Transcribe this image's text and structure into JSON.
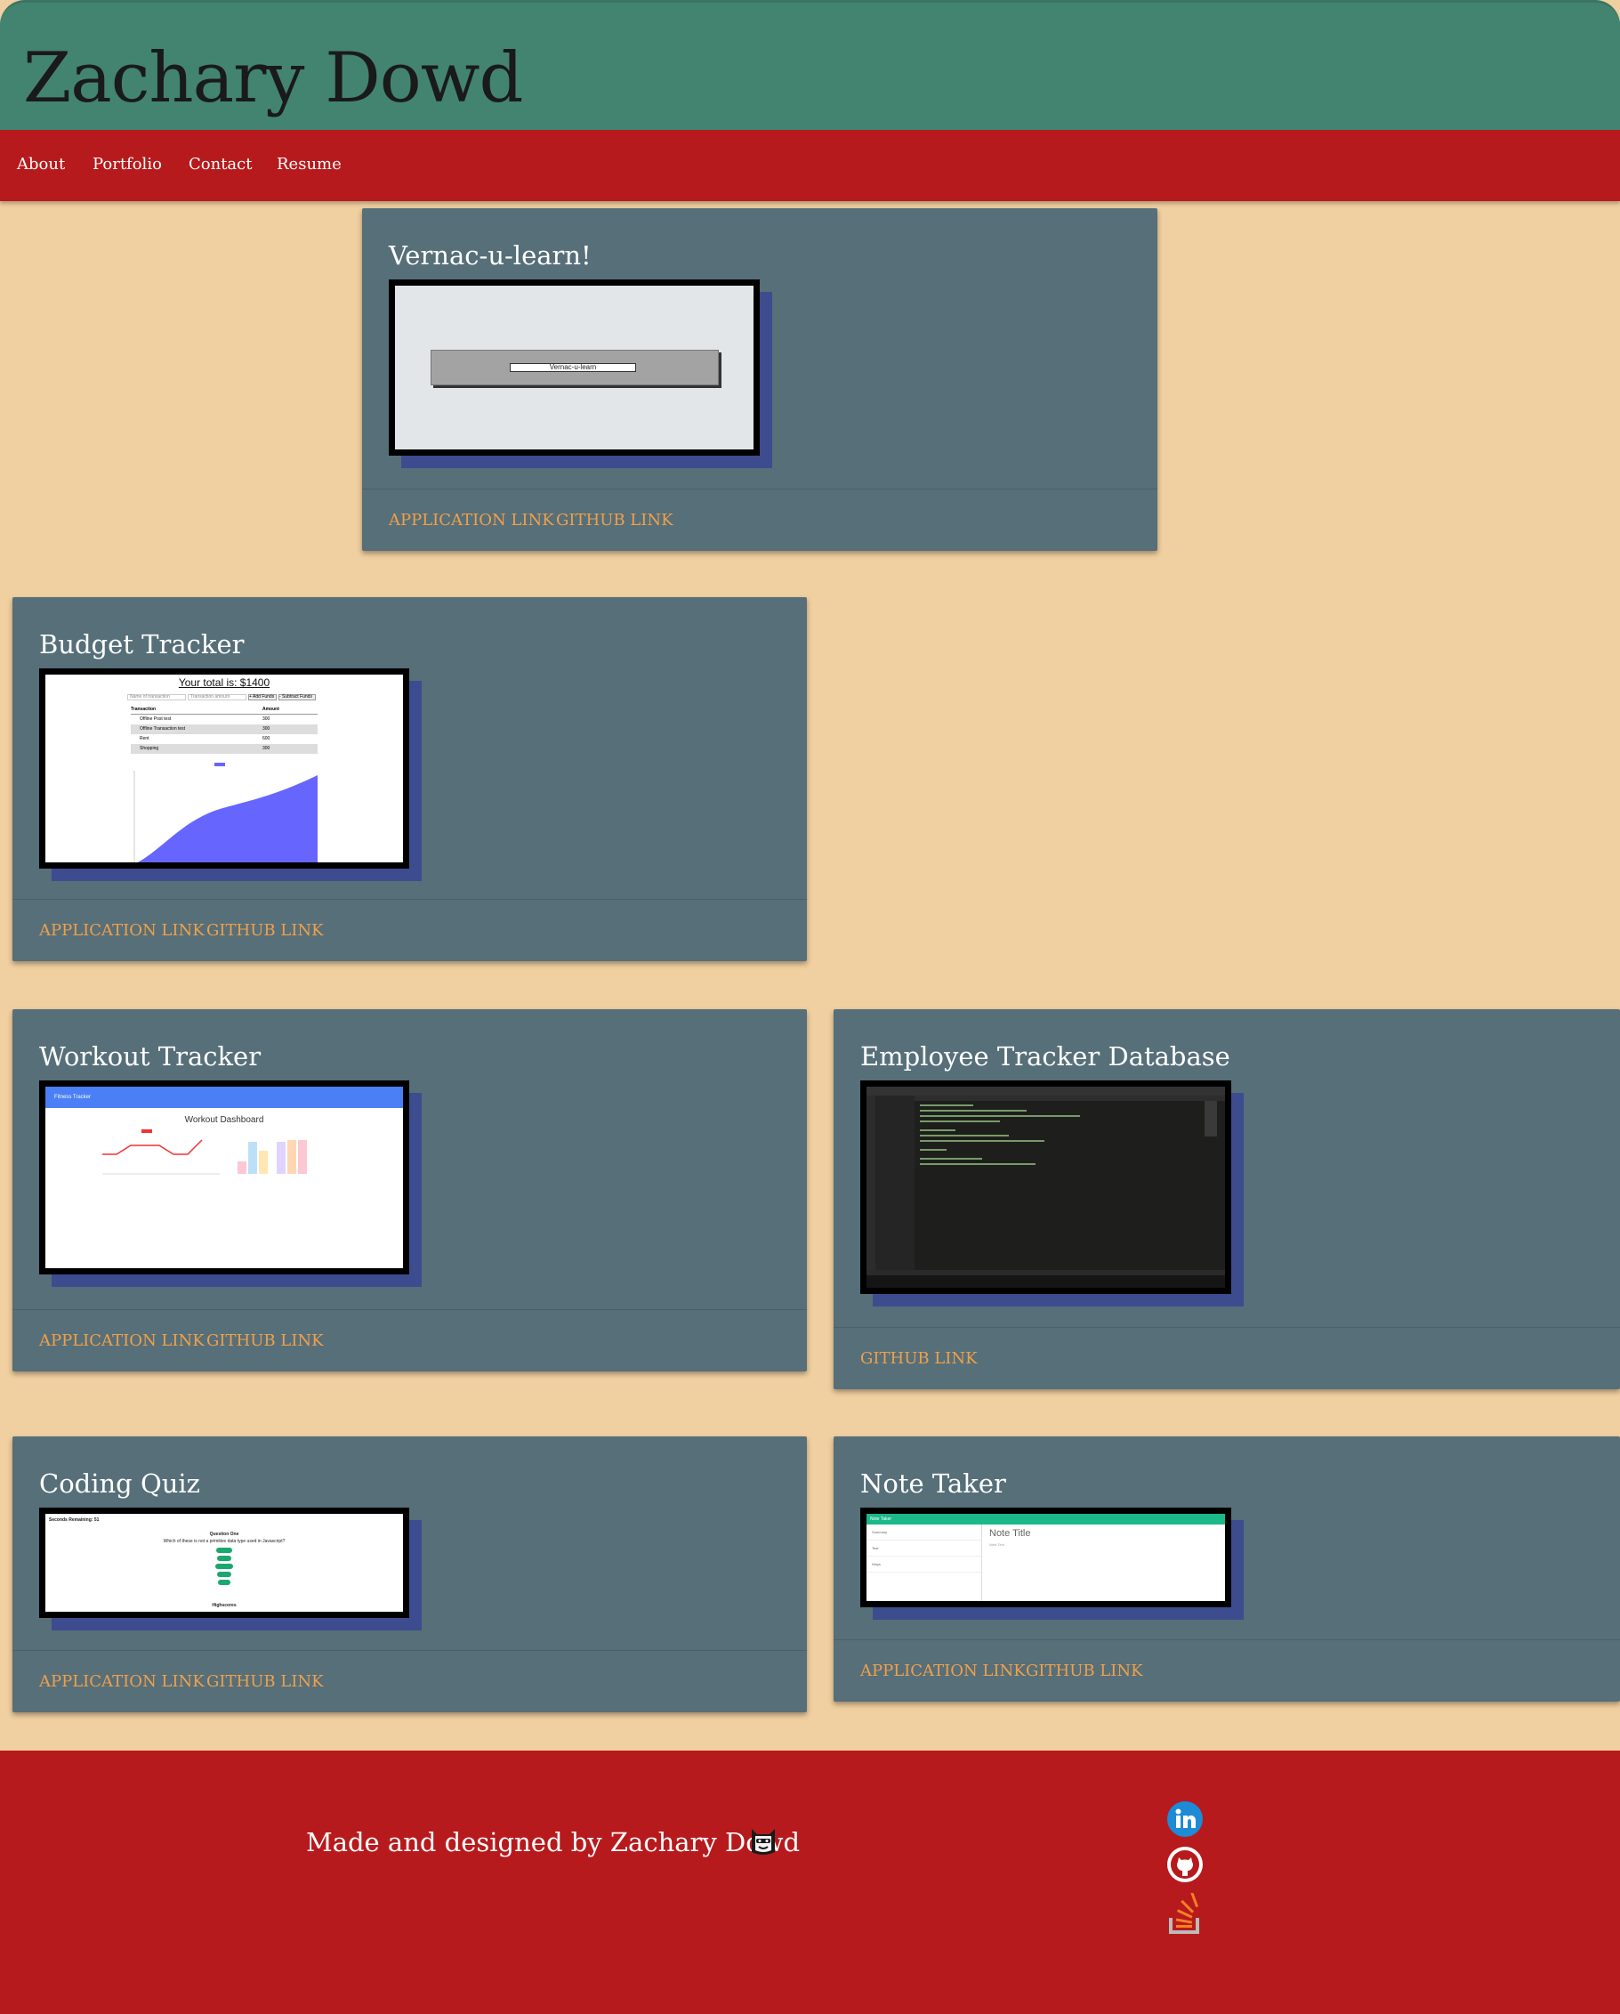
{
  "header": {
    "title": "Zachary Dowd"
  },
  "nav": {
    "items": [
      "About",
      "Portfolio",
      "Contact",
      "Resume"
    ]
  },
  "projects": [
    {
      "title": "Vernac-u-learn!",
      "app_link": "APPLICATION LINK",
      "github_link": "GITHUB LINK",
      "shot": {
        "button_label": "Vernac-u-learn"
      }
    },
    {
      "title": "Budget Tracker",
      "app_link": "APPLICATION LINK",
      "github_link": "GITHUB LINK",
      "shot": {
        "heading": "Your total is: $1400",
        "name_placeholder": "Name of transaction",
        "amount_placeholder": "Transaction amount",
        "add_label": "+ Add Funds",
        "sub_label": "- Subtract Funds",
        "col_transaction": "Transaction",
        "col_amount": "Amount",
        "rows": [
          [
            "Offline Post test",
            "300"
          ],
          [
            "Offline Transaction test",
            "300"
          ],
          [
            "Rent",
            "600"
          ],
          [
            "Shopping",
            "300"
          ]
        ]
      }
    },
    {
      "title": "Workout Tracker",
      "app_link": "APPLICATION LINK",
      "github_link": "GITHUB LINK",
      "shot": {
        "nav_label": "Fitness Tracker",
        "heading": "Workout Dashboard"
      }
    },
    {
      "title": "Employee Tracker Database",
      "github_link": "GITHUB LINK"
    },
    {
      "title": "Coding Quiz",
      "app_link": "APPLICATION LINK",
      "github_link": "GITHUB LINK",
      "shot": {
        "score": "Seconds Remaining: 51",
        "question_title": "Question One",
        "question": "Which of these is not a primitive data type used in Javascript?",
        "footer": "Highscores"
      }
    },
    {
      "title": "Note Taker",
      "app_link": "APPLICATION LINK",
      "github_link": "GITHUB LINK",
      "shot": {
        "nav_label": "Note Taker",
        "note_title": "Note Title",
        "note_text": "Note Text",
        "notes": [
          "Summary",
          "Test",
          "Ways"
        ]
      }
    }
  ],
  "footer": {
    "credit": "Made and designed by Zachary Dowd"
  },
  "colors": {
    "header": "#428470",
    "nav": "#b71a1c",
    "card": "#566f79",
    "link": "#f0a04b",
    "background": "#f0cfa0"
  },
  "icons": [
    "linkedin-icon",
    "github-icon",
    "stackoverflow-icon"
  ]
}
